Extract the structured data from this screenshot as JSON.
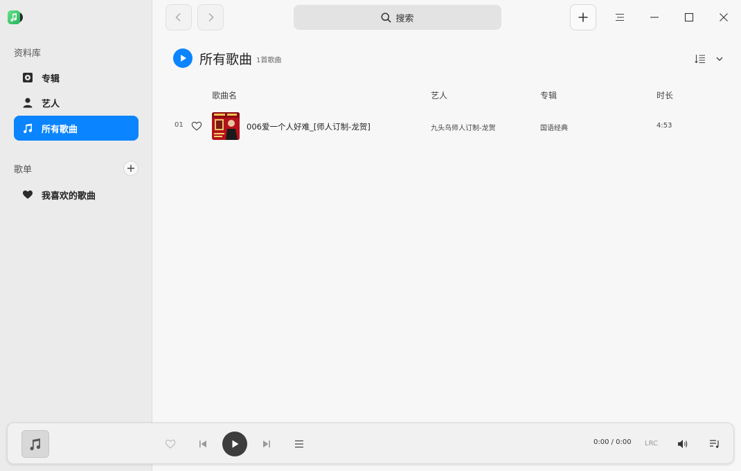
{
  "sidebar": {
    "library_title": "资料库",
    "library_items": [
      {
        "label": "专辑",
        "icon": "album-icon"
      },
      {
        "label": "艺人",
        "icon": "artist-icon"
      },
      {
        "label": "所有歌曲",
        "icon": "music-note-icon",
        "active": true
      }
    ],
    "playlists_title": "歌单",
    "playlist_items": [
      {
        "label": "我喜欢的歌曲",
        "icon": "heart-icon"
      }
    ]
  },
  "topbar": {
    "search_placeholder": "搜索"
  },
  "header": {
    "title": "所有歌曲",
    "count": "1首歌曲"
  },
  "table": {
    "columns": {
      "name": "歌曲名",
      "artist": "艺人",
      "album": "专辑",
      "duration": "时长"
    },
    "rows": [
      {
        "index": "01",
        "name": "006爱一个人好难_[师人订制-龙贺]",
        "artist": "九头鸟师人订制-龙贺",
        "album": "国语经典",
        "duration": "4:53"
      }
    ]
  },
  "player": {
    "time": "0:00 / 0:00",
    "lrc_label": "LRC"
  },
  "colors": {
    "accent": "#0a84ff",
    "sidebar_bg": "#ebebeb",
    "content_bg": "#f7f7f7"
  }
}
